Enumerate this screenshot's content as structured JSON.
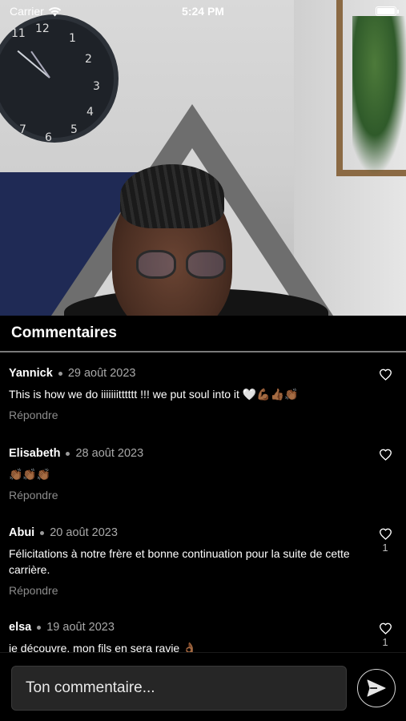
{
  "status_bar": {
    "carrier": "Carrier",
    "time": "5:24 PM"
  },
  "panel": {
    "title": "Commentaires"
  },
  "comments": [
    {
      "author": "Yannick",
      "date": "29 août 2023",
      "text": "This is how we do iiiiiiitttttt !!! we put soul into it 🤍💪🏾👍🏾👏🏾",
      "reply_label": "Répondre",
      "likes": ""
    },
    {
      "author": "Elisabeth",
      "date": "28 août 2023",
      "text": "👏🏾👏🏾👏🏾",
      "reply_label": "Répondre",
      "likes": ""
    },
    {
      "author": "Abui",
      "date": "20 août 2023",
      "text": "Félicitations à notre frère et bonne continuation pour la suite de cette carrière.",
      "reply_label": "Répondre",
      "likes": "1"
    },
    {
      "author": "elsa",
      "date": "19 août 2023",
      "text": "je découvre, mon fils en sera ravie 👌🏾",
      "reply_label": "",
      "likes": "1"
    }
  ],
  "composer": {
    "placeholder": "Ton commentaire..."
  }
}
